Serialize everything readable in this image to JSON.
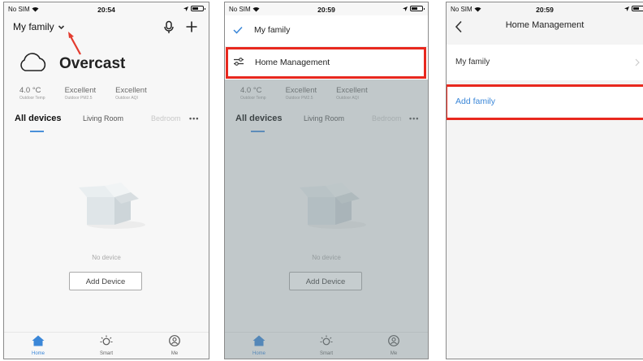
{
  "status": {
    "carrier": "No SIM",
    "wifi_icon": "wifi-icon",
    "battery_icon": "battery-icon",
    "time1": "20:54",
    "time2": "20:59",
    "time3": "20:59"
  },
  "home": {
    "family_name": "My family",
    "weather": {
      "condition": "Overcast",
      "items": [
        {
          "value": "4.0 °C",
          "label": "Outdoor Temp"
        },
        {
          "value": "Excellent",
          "label": "Outdoor PM2.5"
        },
        {
          "value": "Excellent",
          "label": "Outdoor AQI"
        }
      ]
    },
    "tabs": [
      "All devices",
      "Living Room",
      "Bedroom"
    ],
    "more": "•••",
    "empty_text": "No device",
    "add_device": "Add Device"
  },
  "bottom_nav": [
    {
      "label": "Home",
      "icon": "home-icon",
      "active": true
    },
    {
      "label": "Smart",
      "icon": "sun-icon",
      "active": false
    },
    {
      "label": "Me",
      "icon": "person-icon",
      "active": false
    }
  ],
  "dropdown": {
    "family_item": "My family",
    "manage_item": "Home Management"
  },
  "management": {
    "title": "Home Management",
    "family_item": "My family",
    "add_family": "Add family"
  },
  "colors": {
    "accent": "#3b87d8",
    "highlight": "#e8281e",
    "arrow": "#e33b2e"
  }
}
